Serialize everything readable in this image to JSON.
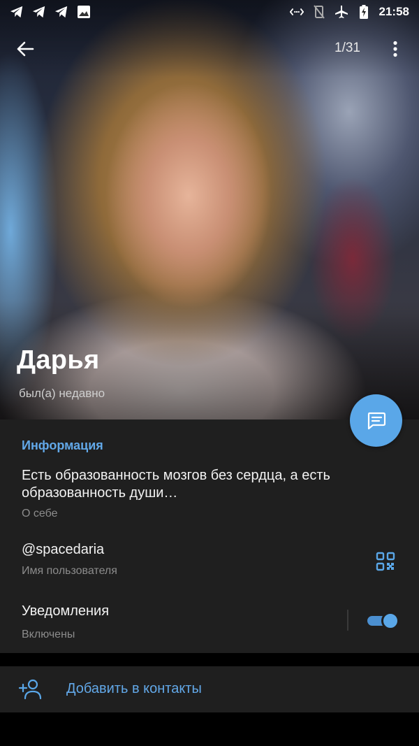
{
  "status_bar": {
    "time": "21:58",
    "left_icons": [
      "telegram-icon",
      "telegram-icon",
      "telegram-icon",
      "image-icon"
    ],
    "right_icons": [
      "nfc-icon",
      "vibrate-icon",
      "airplane-icon",
      "battery-charging-icon"
    ]
  },
  "header": {
    "counter": "1/31",
    "name": "Дарья",
    "status": "был(а) недавно"
  },
  "info": {
    "section_title": "Информация",
    "bio": "Есть образованность мозгов без сердца, а есть образованность души…",
    "bio_label": "О себе",
    "username": "@spacedaria",
    "username_label": "Имя пользователя",
    "notifications": "Уведомления",
    "notifications_state": "Включены",
    "notifications_on": true
  },
  "actions": {
    "add_contact": "Добавить в контакты"
  },
  "colors": {
    "accent": "#5aa7e8",
    "link_text": "#62a8e8",
    "panel": "#1f1f1f",
    "secondary_text": "#8c8c8c"
  }
}
